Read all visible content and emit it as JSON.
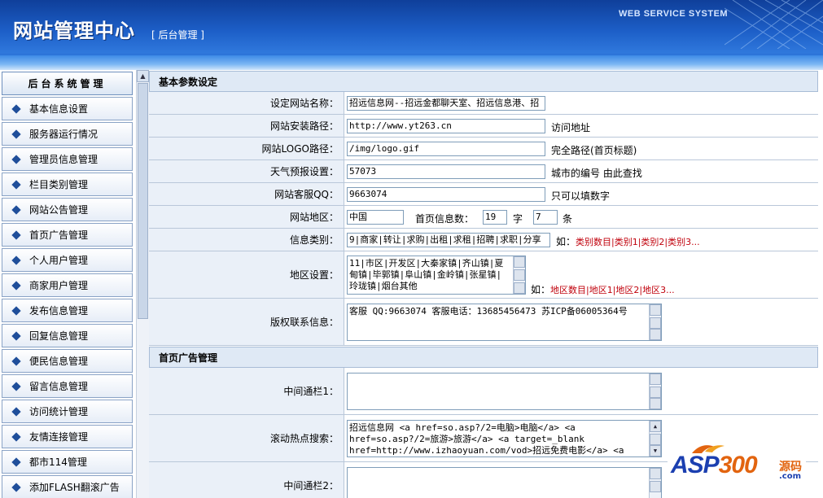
{
  "header": {
    "title": "网站管理中心",
    "subtitle": "[ 后台管理 ]",
    "system": "WEB SERVICE SYSTEM"
  },
  "sidebar": {
    "title": "后台系统管理",
    "items": [
      {
        "label": "基本信息设置"
      },
      {
        "label": "服务器运行情况"
      },
      {
        "label": "管理员信息管理"
      },
      {
        "label": "栏目类别管理"
      },
      {
        "label": "网站公告管理"
      },
      {
        "label": "首页广告管理"
      },
      {
        "label": "个人用户管理"
      },
      {
        "label": "商家用户管理"
      },
      {
        "label": "发布信息管理"
      },
      {
        "label": "回复信息管理"
      },
      {
        "label": "便民信息管理"
      },
      {
        "label": "留言信息管理"
      },
      {
        "label": "访问统计管理"
      },
      {
        "label": "友情连接管理"
      },
      {
        "label": "都市114管理"
      },
      {
        "label": "添加FLASH翻滚广告"
      }
    ]
  },
  "basic": {
    "section_title": "基本参数设定",
    "site_name_label": "设定网站名称：",
    "site_name_value": "招远信息网--招远金都聊天室、招远信息港、招",
    "site_path_label": "网站安装路径：",
    "site_path_value": "http://www.yt263.cn",
    "site_path_hint": "访问地址",
    "logo_label": "网站LOGO路径：",
    "logo_value": "/img/logo.gif",
    "logo_hint": "完全路径(首页标题)",
    "weather_label": "天气预报设置：",
    "weather_value": "57073",
    "weather_hint": "城市的编号 由此查找",
    "qq_label": "网站客服QQ：",
    "qq_value": "9663074",
    "qq_hint": "只可以填数字",
    "region_label": "网站地区：",
    "region_value": "中国",
    "home_info_label": "首页信息数：",
    "home_info_chars": "19",
    "char_unit": "字",
    "home_info_count": "7",
    "count_unit": "条",
    "category_label": "信息类别：",
    "category_value": "9|商家|转让|求购|出租|求租|招聘|求职|分享",
    "category_hint_prefix": "如：",
    "category_hint": "类别数目|类别1|类别2|类别3...",
    "area_label": "地区设置：",
    "area_value": "11|市区|开发区|大秦家镇|齐山镇|夏甸镇|毕郭镇|阜山镇|金岭镇|张星镇|玲珑镇|烟台其他",
    "area_hint_prefix": "如：",
    "area_hint": "地区数目|地区1|地区2|地区3...",
    "copyright_label": "版权联系信息：",
    "copyright_value": "客服 QQ:9663074  客服电话：13685456473 苏ICP备06005364号"
  },
  "ads": {
    "section_title": "首页广告管理",
    "middle1_label": "中间通栏1：",
    "middle1_value": "",
    "scroll_label": "滚动热点搜索：",
    "scroll_value": "招远信息网 <a href=so.asp?/2=电脑>电脑</a> <a href=so.asp?/2=旅游>旅游</a> <a target=_blank href=http://www.izhaoyuan.com/vod>招远免费电影</a> <a",
    "middle2_label": "中间通栏2：",
    "middle2_value": ""
  },
  "watermark": {
    "brand_a": "ASP",
    "brand_b": "300",
    "suffix_cn": "源码",
    "suffix_com": ".com"
  },
  "colors": {
    "header_blue": "#1d5fc8",
    "accent_red": "#c0000b",
    "label_bg": "#eaf0f8"
  }
}
